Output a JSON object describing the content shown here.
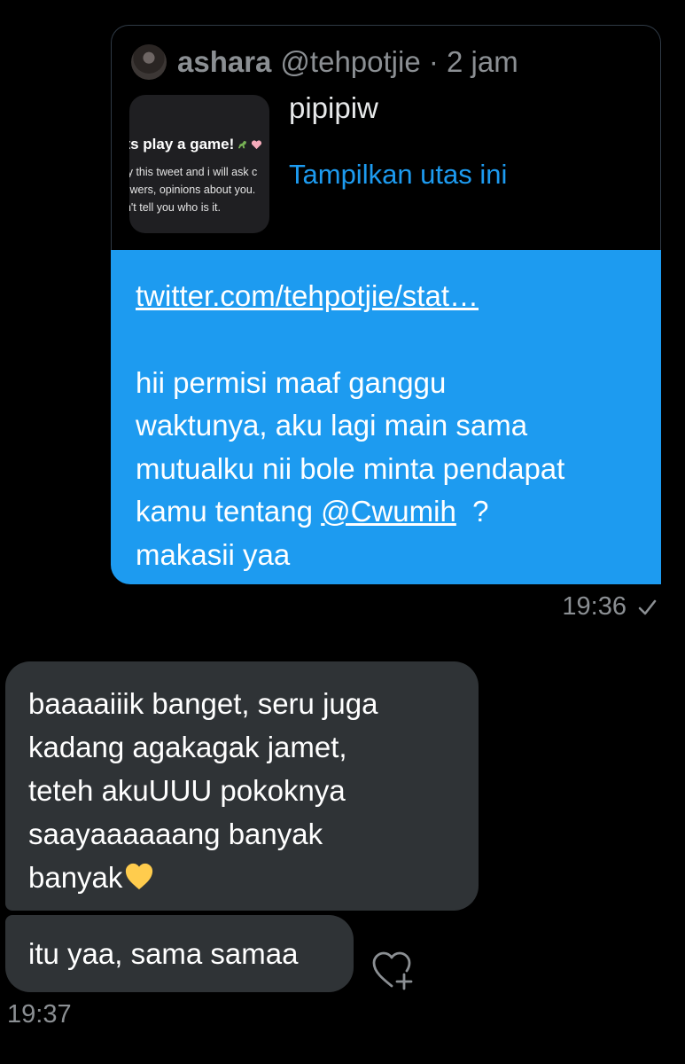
{
  "quoted_tweet": {
    "author_name": "ashara",
    "author_handle": "@tehpotjie",
    "separator": " · ",
    "time_ago": "2 jam",
    "text": "pipipiw",
    "show_thread": "Tampilkan utas ini",
    "image": {
      "title": "ets play a game!",
      "lines": [
        "ply this tweet and i will ask c",
        "llowers, opinions about you.",
        "on't tell you who is it."
      ]
    }
  },
  "sent_message": {
    "link": "twitter.com/tehpotjie/stat…",
    "line1": "hii permisi maaf ganggu",
    "line2": "waktunya, aku lagi main sama",
    "line3": "mutualku nii bole minta pendapat",
    "line4_prefix": "kamu tentang ",
    "mention": "@Cwumih",
    "line4_suffix": "  ?",
    "line5": "makasii yaa",
    "time": "19:36",
    "status_icon": "check-icon"
  },
  "received_messages": [
    {
      "lines": [
        "baaaaiiik banget, seru juga",
        "kadang agakagak jamet,",
        "teteh akuUUU pokoknya",
        "saayaaaaaang banyak",
        "banyak"
      ],
      "emoji": "yellow-heart-icon"
    },
    {
      "lines": [
        "itu yaa, sama samaa"
      ],
      "react_icon": "heart-plus-icon"
    }
  ],
  "received_time": "19:37",
  "colors": {
    "background": "#000000",
    "sent_bubble": "#1d9bf0",
    "received_bubble": "#2f3336",
    "muted_text": "#8b8f93",
    "link": "#1d9bf0",
    "heart": "#ffcc4d"
  }
}
